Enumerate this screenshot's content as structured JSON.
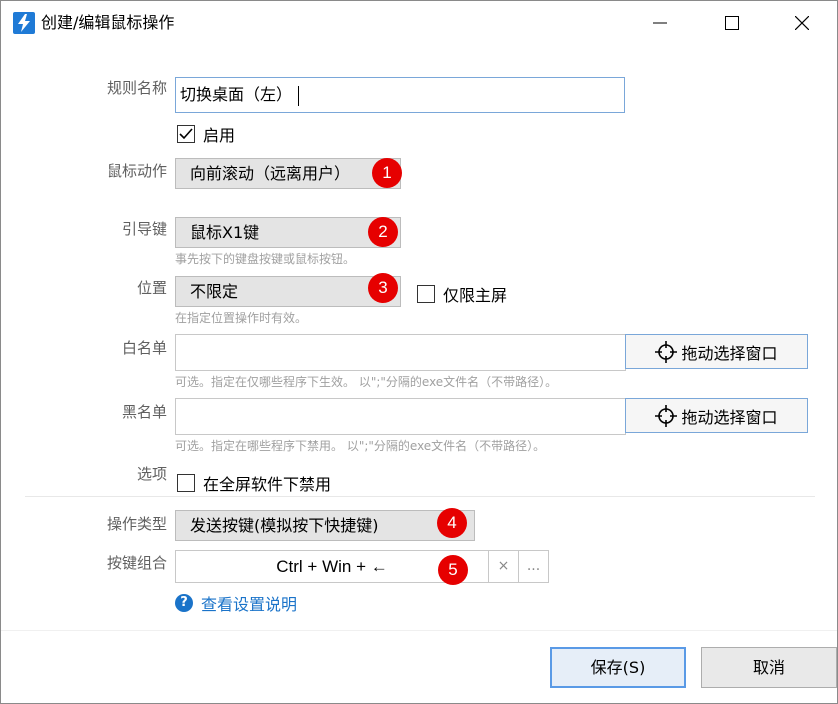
{
  "window": {
    "title": "创建/编辑鼠标操作",
    "icon": "lightning-icon"
  },
  "form": {
    "rule_name": {
      "label": "规则名称",
      "value": "切换桌面（左）"
    },
    "enabled": {
      "label": "启用",
      "checked": true
    },
    "mouse_action": {
      "label": "鼠标动作",
      "value": "向前滚动（远离用户）",
      "badge": "1"
    },
    "lead_key": {
      "label": "引导键",
      "value": "鼠标X1键",
      "badge": "2",
      "hint": "事先按下的键盘按键或鼠标按钮。"
    },
    "position": {
      "label": "位置",
      "value": "不限定",
      "badge": "3",
      "hint": "在指定位置操作时有效。",
      "primary_only": {
        "label": "仅限主屏",
        "checked": false
      }
    },
    "whitelist": {
      "label": "白名单",
      "value": "",
      "pick_label": "拖动选择窗口",
      "hint": "可选。指定在仅哪些程序下生效。 以\";\"分隔的exe文件名（不带路径）。"
    },
    "blacklist": {
      "label": "黑名单",
      "value": "",
      "pick_label": "拖动选择窗口",
      "hint": "可选。指定在哪些程序下禁用。 以\";\"分隔的exe文件名（不带路径）。"
    },
    "options": {
      "label": "选项",
      "fullscreen_disable": {
        "label": "在全屏软件下禁用",
        "checked": false
      }
    },
    "operation_type": {
      "label": "操作类型",
      "value": "发送按键(模拟按下快捷键)",
      "badge": "4"
    },
    "key_combo": {
      "label": "按键组合",
      "value": "Ctrl + Win + ←",
      "badge": "5",
      "clear_label": "×",
      "more_label": "..."
    },
    "help_link": "查看设置说明"
  },
  "footer": {
    "save_label": "保存(S)",
    "cancel_label": "取消"
  }
}
